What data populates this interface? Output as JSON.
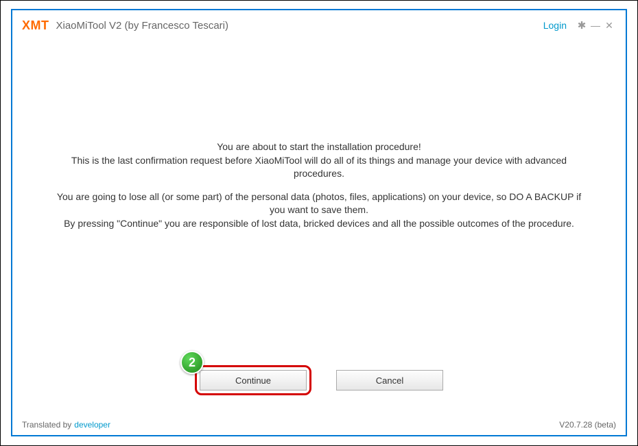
{
  "header": {
    "logo": "XMT",
    "title": "XiaoMiTool V2 (by Francesco Tescari)",
    "login": "Login"
  },
  "content": {
    "p1": "You are about to start the installation procedure!\nThis is the last confirmation request before XiaoMiTool will do all of its things and manage your device with advanced procedures.",
    "p2": "You are going to lose all (or some part) of the personal data (photos, files, applications) on your device, so DO A BACKUP if you want to save them.\nBy pressing \"Continue\" you are responsible of lost data, bricked devices and all the possible outcomes of the procedure."
  },
  "buttons": {
    "continue": "Continue",
    "cancel": "Cancel"
  },
  "annotation": {
    "badge": "2"
  },
  "footer": {
    "translated": "Translated by",
    "developer": "developer",
    "version": "V20.7.28 (beta)"
  }
}
